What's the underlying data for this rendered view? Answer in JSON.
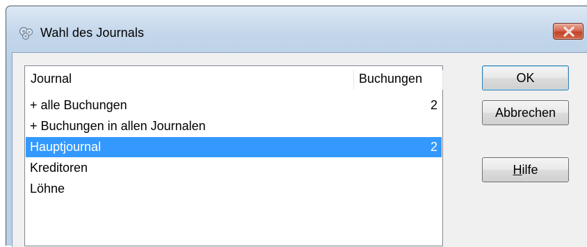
{
  "window": {
    "title": "Wahl des Journals",
    "title_icon": "journal-selection-icon",
    "close_icon": "close-icon"
  },
  "list": {
    "columns": [
      "Journal",
      "Buchungen"
    ],
    "rows": [
      {
        "name": "+ alle Buchungen",
        "count": "2",
        "selected": false
      },
      {
        "name": "+ Buchungen in allen Journalen",
        "count": "",
        "selected": false
      },
      {
        "name": "Hauptjournal",
        "count": "2",
        "selected": true
      },
      {
        "name": "Kreditoren",
        "count": "",
        "selected": false
      },
      {
        "name": "Löhne",
        "count": "",
        "selected": false
      }
    ]
  },
  "buttons": {
    "ok": "OK",
    "cancel": "Abbrechen",
    "help_mnemonic": "H",
    "help_rest": "ilfe"
  },
  "colors": {
    "selection": "#3399ff",
    "close_button": "#c4432a",
    "frame": "#bcd1e8"
  }
}
